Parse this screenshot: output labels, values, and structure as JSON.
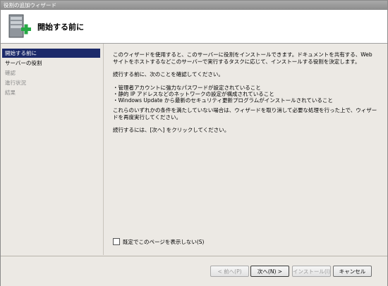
{
  "window": {
    "title": "役割の追加ウィザード"
  },
  "banner": {
    "title": "開始する前に",
    "icon": "server-with-add-icon"
  },
  "sidebar": {
    "items": [
      {
        "label": "開始する前に",
        "state": "active"
      },
      {
        "label": "サーバーの役割",
        "state": "enabled"
      },
      {
        "label": "確認",
        "state": "disabled"
      },
      {
        "label": "進行状況",
        "state": "disabled"
      },
      {
        "label": "結果",
        "state": "disabled"
      }
    ]
  },
  "content": {
    "intro": "このウィザードを使用すると、このサーバーに役割をインストールできます。ドキュメントを共有する、Web サイトをホストするなどこのサーバーで実行するタスクに応じて、インストールする役割を決定します。",
    "before": "続行する前に、次のことを確認してください。",
    "bullets": [
      "・管理者アカウントに強力なパスワードが設定されていること",
      "・静的 IP アドレスなどのネットワークの設定が構成されていること",
      "・Windows Update から最新のセキュリティ更新プログラムがインストールされていること"
    ],
    "condition": "これらのいずれかの条件を満たしていない場合は、ウィザードを取り消して必要な処理を行った上で、ウィザードを再度実行してください。",
    "next_hint": "続行するには、[次へ] をクリックしてください。",
    "skip_checkbox": {
      "label": "既定でこのページを表示しない(S)",
      "checked": false
    }
  },
  "footer": {
    "back": "< 前へ(P)",
    "next": "次へ(N) >",
    "install": "インストール(I)",
    "cancel": "キャンセル"
  }
}
